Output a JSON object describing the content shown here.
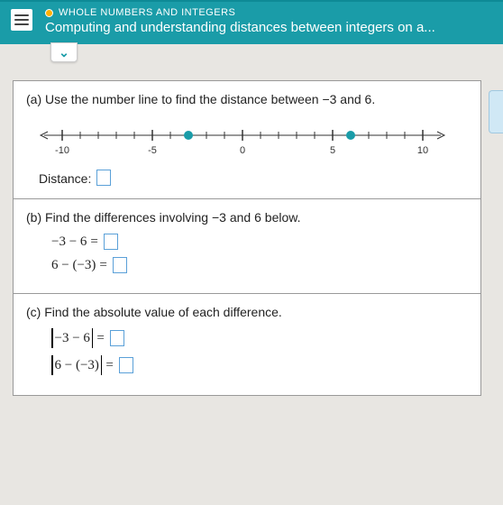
{
  "header": {
    "topic": "WHOLE NUMBERS AND INTEGERS",
    "subtitle": "Computing and understanding distances between integers on a..."
  },
  "numberline": {
    "ticks": [
      "-10",
      "-5",
      "0",
      "5",
      "10"
    ],
    "point_a": -3,
    "point_b": 6
  },
  "parts": {
    "a": {
      "label": "(a)",
      "text_pre": "Use the number line to find the distance between ",
      "val1": "−3",
      "mid": " and ",
      "val2": "6",
      "post": ".",
      "distance_label": "Distance:"
    },
    "b": {
      "label": "(b)",
      "text_pre": "Find the differences involving ",
      "val1": "−3",
      "mid": " and ",
      "val2": "6",
      "post": " below.",
      "eq1_lhs": "−3 − 6",
      "eq2_lhs": "6 − (−3)",
      "eq_sym": "="
    },
    "c": {
      "label": "(c)",
      "text": "Find the absolute value of each difference.",
      "abs1": "−3 − 6",
      "abs2": "6 − (−3)",
      "eq_sym": "="
    }
  }
}
